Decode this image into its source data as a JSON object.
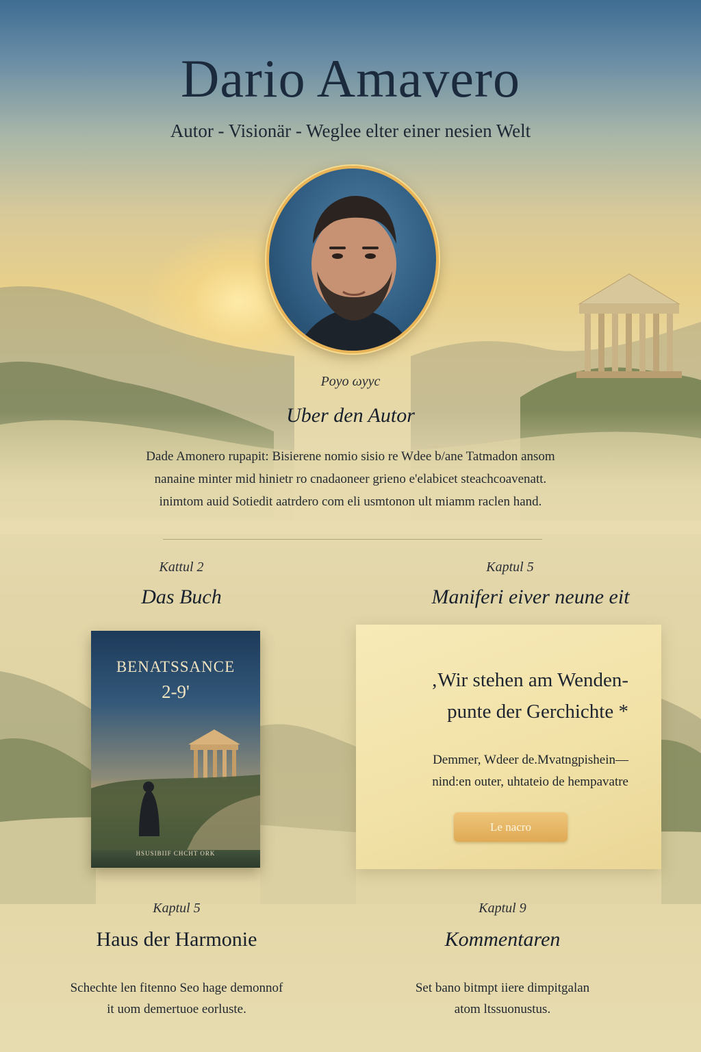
{
  "header": {
    "title": "Dario Amavero",
    "subtitle": "Autor - Visionär - Weglee elter einer nesien Welt"
  },
  "about": {
    "kicker": "Poyo ωyyc",
    "heading": "Uber den Autor",
    "lines": [
      "Dade Amonero rupapit: Bisierene nomio sisio re Wdee b/ane Tatmadon ansom",
      "nanaine minter mid hinietr ro cnadaoneer grieno e'elabicet steachcoavenatt.",
      "inimtom auid Sotiedit aatrdero com eli usmtonon ult miamm raclen hand."
    ]
  },
  "book_section": {
    "kicker": "Kattul 2",
    "heading": "Das Buch",
    "cover_title": "BENATSSANCE",
    "cover_subtitle": "2-9'",
    "cover_footer": "HSUSIBIIF CHCHT ORK"
  },
  "manifest": {
    "kicker": "Kaptul 5",
    "heading": "Maniferi eiver neune eit",
    "quote_line1": "‚Wir stehen am Wenden-",
    "quote_line2": "punte der Gerchichte *",
    "text_line1": "Demmer, Wdeer de.Mvatngpishein—",
    "text_line2": "nind:en outer, uhtateio de hempavatre",
    "button_label": "Le nacro"
  },
  "harmony": {
    "kicker": "Kaptul 5",
    "heading": "Haus der Harmonie",
    "line1": "Schechte len fitenno Seo hage demonnof",
    "line2": "it uom demertuoe eorluste."
  },
  "comments": {
    "kicker": "Kaptul 9",
    "heading": "Kommentaren",
    "line1": "Set bano bitmpt iiere dimpitgalan",
    "line2": "atom ltssuonustus."
  },
  "colors": {
    "accent_gold": "#e8b457",
    "button_gold": "#e0aa55",
    "title_navy": "#1b2a3d"
  }
}
